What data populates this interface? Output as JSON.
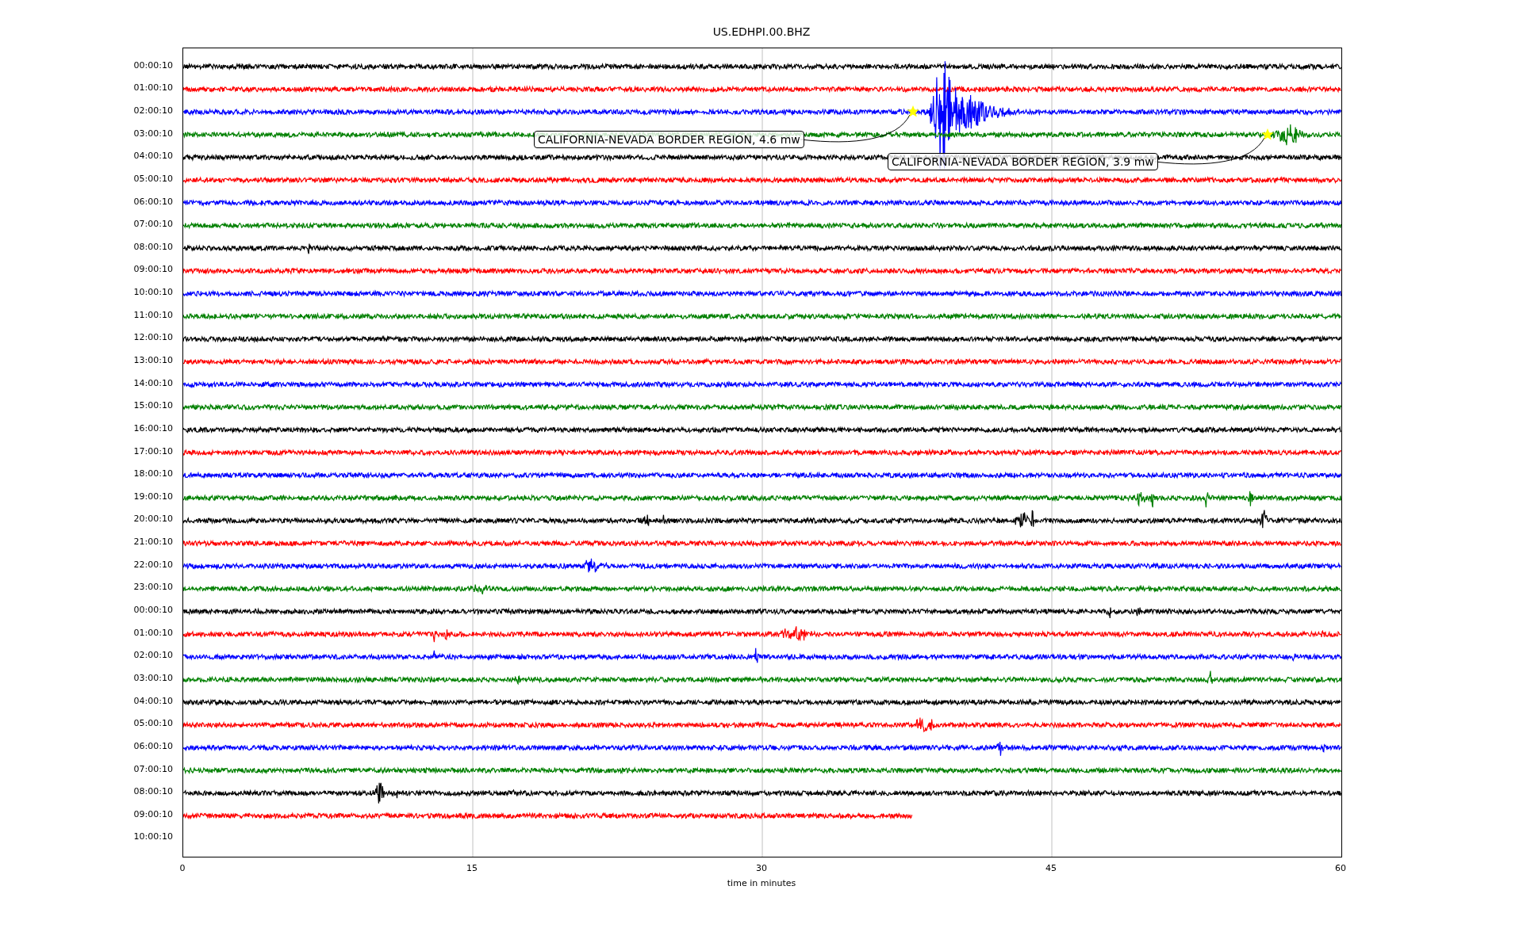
{
  "title": "US.EDHPI.00.BHZ",
  "rows": [
    {
      "label": "00:00:10",
      "color": "#000000"
    },
    {
      "label": "01:00:10",
      "color": "#ff0000"
    },
    {
      "label": "02:00:10",
      "color": "#0000ff"
    },
    {
      "label": "03:00:10",
      "color": "#008000"
    },
    {
      "label": "04:00:10",
      "color": "#000000"
    },
    {
      "label": "05:00:10",
      "color": "#ff0000"
    },
    {
      "label": "06:00:10",
      "color": "#0000ff"
    },
    {
      "label": "07:00:10",
      "color": "#008000"
    },
    {
      "label": "08:00:10",
      "color": "#000000"
    },
    {
      "label": "09:00:10",
      "color": "#ff0000"
    },
    {
      "label": "10:00:10",
      "color": "#0000ff"
    },
    {
      "label": "11:00:10",
      "color": "#008000"
    },
    {
      "label": "12:00:10",
      "color": "#000000"
    },
    {
      "label": "13:00:10",
      "color": "#ff0000"
    },
    {
      "label": "14:00:10",
      "color": "#0000ff"
    },
    {
      "label": "15:00:10",
      "color": "#008000"
    },
    {
      "label": "16:00:10",
      "color": "#000000"
    },
    {
      "label": "17:00:10",
      "color": "#ff0000"
    },
    {
      "label": "18:00:10",
      "color": "#0000ff"
    },
    {
      "label": "19:00:10",
      "color": "#008000"
    },
    {
      "label": "20:00:10",
      "color": "#000000"
    },
    {
      "label": "21:00:10",
      "color": "#ff0000"
    },
    {
      "label": "22:00:10",
      "color": "#0000ff"
    },
    {
      "label": "23:00:10",
      "color": "#008000"
    },
    {
      "label": "00:00:10",
      "color": "#000000"
    },
    {
      "label": "01:00:10",
      "color": "#ff0000"
    },
    {
      "label": "02:00:10",
      "color": "#0000ff"
    },
    {
      "label": "03:00:10",
      "color": "#008000"
    },
    {
      "label": "04:00:10",
      "color": "#000000"
    },
    {
      "label": "05:00:10",
      "color": "#ff0000"
    },
    {
      "label": "06:00:10",
      "color": "#0000ff"
    },
    {
      "label": "07:00:10",
      "color": "#008000"
    },
    {
      "label": "08:00:10",
      "color": "#000000"
    },
    {
      "label": "09:00:10",
      "color": "#ff0000",
      "level": 0.63
    },
    {
      "label": "10:00:10"
    }
  ],
  "annotations": [
    {
      "text": "CALIFORNIA-NEVADA BORDER REGION, 4.6 mw"
    },
    {
      "text": "CALIFORNIA-NEVADA BORDER REGION, 3.9 mw"
    }
  ],
  "x_ticks": [
    "0",
    "15",
    "30",
    "45",
    "60"
  ],
  "xlabel": "time in minutes"
}
